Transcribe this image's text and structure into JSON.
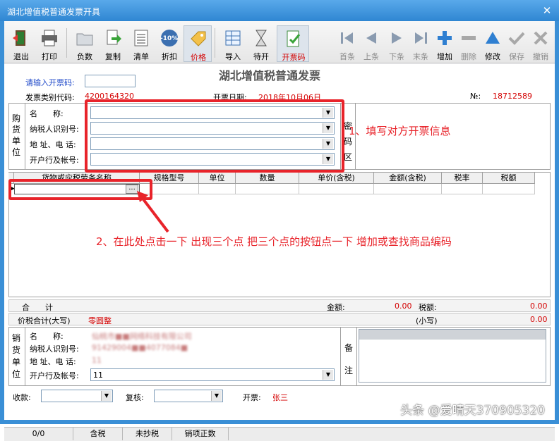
{
  "window": {
    "title": "湖北增值税普通发票开具"
  },
  "toolbar": {
    "items": [
      {
        "label": "退出"
      },
      {
        "label": "打印"
      },
      {
        "label": "负数"
      },
      {
        "label": "复制"
      },
      {
        "label": "清单"
      },
      {
        "label": "折扣"
      },
      {
        "label": "价格"
      },
      {
        "label": "导入"
      },
      {
        "label": "待开"
      },
      {
        "label": "开票码"
      },
      {
        "label": "首条"
      },
      {
        "label": "上条"
      },
      {
        "label": "下条"
      },
      {
        "label": "末条"
      },
      {
        "label": "增加"
      },
      {
        "label": "删除"
      },
      {
        "label": "修改"
      },
      {
        "label": "保存"
      },
      {
        "label": "撤销"
      }
    ],
    "discount_icon_text": "-10%"
  },
  "invoice": {
    "heading": "湖北增值税普通发票",
    "code_input_label": "请输入开票码:",
    "code_input_value": "",
    "type_code_label": "发票类别代码:",
    "type_code_value": "4200164320",
    "date_label": "开票日期:",
    "date_value": "2018年10月06日",
    "no_label": "№:",
    "no_value": "18712589"
  },
  "buyer": {
    "section_label": "购货单位",
    "name_label": "名　　称:",
    "tax_id_label": "纳税人识别号:",
    "address_label": "地 址、电 话:",
    "bank_label": "开户行及帐号:",
    "cipher_label": "密码区"
  },
  "goods_table": {
    "columns": [
      "货物或应税劳务名称",
      "规格型号",
      "单位",
      "数量",
      "单价(含税)",
      "金额(含税)",
      "税率",
      "税额"
    ],
    "ellipsis_button": "..."
  },
  "totals": {
    "label": "合　　计",
    "amount_label": "金额:",
    "amount_value": "0.00",
    "tax_label": "税额:",
    "tax_value": "0.00",
    "capital_label": "价税合计(大写)",
    "capital_value": "零圆整",
    "small_label": "(小写)",
    "small_value": "0.00"
  },
  "seller": {
    "section_label": "销货单位",
    "name_label": "名　　称:",
    "tax_id_label": "纳税人识别号:",
    "address_label": "地 址、电 话:",
    "bank_label": "开户行及帐号:",
    "name_value": "仙桃市■■网络科技有限公司",
    "tax_id_value": "91429004■■4077084■",
    "address_value": "11",
    "bank_value": "11",
    "remark_label": "备注"
  },
  "footer": {
    "payee_label": "收款:",
    "reviewer_label": "复核:",
    "drawer_label": "开票:",
    "drawer_value": "张三"
  },
  "statusbar": {
    "count": "0/0",
    "tax_mode": "含税",
    "copy_state": "未抄税",
    "sales_state": "销项正数"
  },
  "annotations": {
    "step1": "1、填写对方开票信息",
    "step2": "2、在此处点击一下 出现三个点 把三个点的按钮点一下 增加或查找商品编码"
  },
  "watermark": "头条 @爱晴天370905320",
  "colors": {
    "annotation": "#e8232a",
    "title_bar": "#3a8fd6",
    "label_blue": "#1f49c9",
    "label_red": "#d40000"
  }
}
